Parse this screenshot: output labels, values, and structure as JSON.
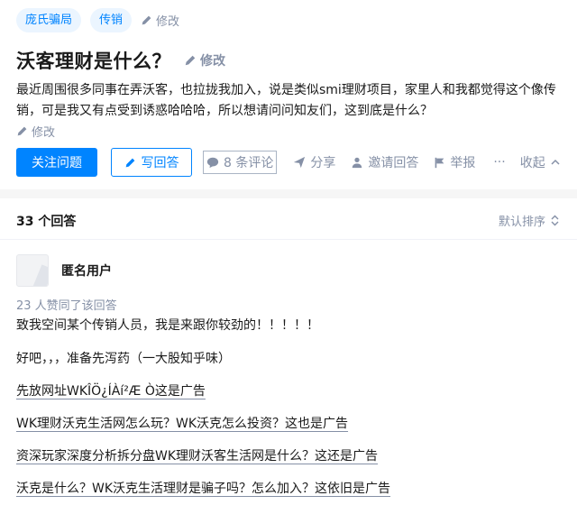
{
  "question": {
    "topics": [
      "庞氏骗局",
      "传销"
    ],
    "topics_edit": "修改",
    "title": "沃客理财是什么？",
    "title_edit": "修改",
    "detail": "最近周围很多同事在弄沃客，也拉拢我加入，说是类似smi理财项目，家里人和我都觉得这个像传销，可是我又有点受到诱惑哈哈哈，所以想请问问知友们，这到底是什么？",
    "detail_edit": "修改"
  },
  "actions": {
    "follow": "关注问题",
    "write_answer": "写回答",
    "comments": "8 条评论",
    "share": "分享",
    "invite": "邀请回答",
    "report": "举报",
    "more": "···",
    "collapse": "收起"
  },
  "answers_header": {
    "count": "33 个回答",
    "sort": "默认排序"
  },
  "answer": {
    "author": "匿名用户",
    "votes": "23 人赞同了该回答",
    "lines": [
      "致我空间某个传销人员，我是来跟你较劲的！！！！！",
      "好吧，，，准备先泻药（一大股知乎味）",
      "先放网址WKÎÖ¿ÍÀí²Æ Ò这是广告",
      "WK理财沃克生活网怎么玩？WK沃克怎么投资？这也是广告",
      "资深玩家深度分析拆分盘WK理财沃客生活网是什么？这还是广告",
      "沃克是什么？WK沃克生活理财是骗子吗？怎么加入？这依旧是广告"
    ]
  },
  "colors": {
    "brand": "#0084ff",
    "muted": "#8590a6",
    "tag_bg": "#ebf5ff"
  }
}
